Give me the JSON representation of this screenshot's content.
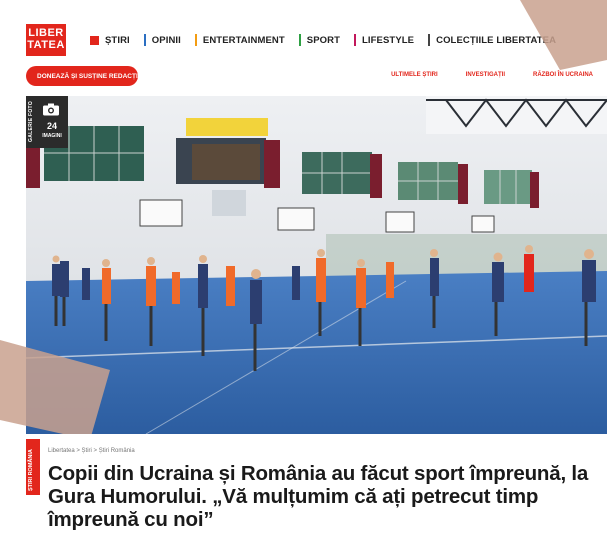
{
  "logo": {
    "line1": "LIBER",
    "line2": "TATEA"
  },
  "nav": {
    "items": [
      {
        "label": "ȘTIRI",
        "color": "#e2261c"
      },
      {
        "label": "OPINII",
        "color": "#2b6fc2"
      },
      {
        "label": "ENTERTAINMENT",
        "color": "#f39c12"
      },
      {
        "label": "SPORT",
        "color": "#2ea043"
      },
      {
        "label": "LIFESTYLE",
        "color": "#c2185b"
      },
      {
        "label": "COLECȚIILE LIBERTATEA",
        "color": "#444444"
      }
    ]
  },
  "subbar": {
    "donate_label": "DONEAZĂ ȘI SUSȚINE REDACȚIA",
    "links": [
      "ULTIMELE ȘTIRI",
      "INVESTIGAȚII",
      "RĂZBOI ÎN UCRAINA"
    ]
  },
  "gallery": {
    "side_label": "GALERIE FOTO",
    "count": "24",
    "label": "IMAGINI"
  },
  "article": {
    "tag": "ȘTIRI ROMÂNIA",
    "breadcrumb": "Libertatea > Știri > Știri România",
    "title": "Copii din Ucraina și România au făcut sport împreună, la Gura Humorului. „Vă mulțumim că ați petrecut timp împreună cu noi”"
  },
  "colors": {
    "brand": "#e2261c",
    "court": "#3d6fb4",
    "wall": "#e7e9ec"
  }
}
